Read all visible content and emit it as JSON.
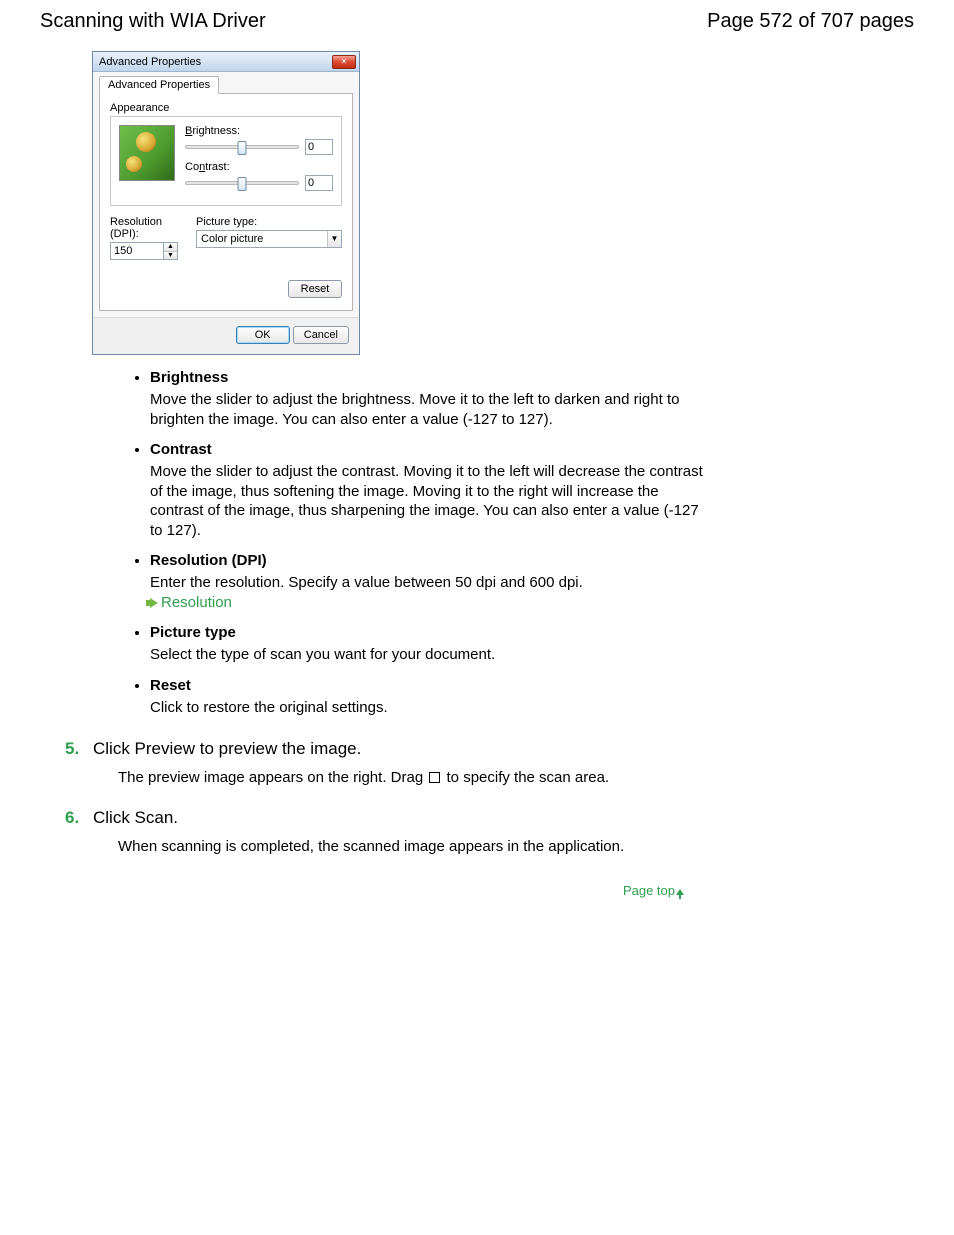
{
  "header": {
    "title": "Scanning with WIA Driver",
    "page_info": "Page 572 of 707 pages"
  },
  "dialog": {
    "title": "Advanced Properties",
    "tab_label": "Advanced Properties",
    "appearance_label": "Appearance",
    "brightness_label_pre": "B",
    "brightness_label_rest": "rightness:",
    "brightness_value": "0",
    "contrast_label_pre": "Co",
    "contrast_label_u": "n",
    "contrast_label_rest": "trast:",
    "contrast_value": "0",
    "resolution_label_pre": "R",
    "resolution_label_rest": "esolution (DPI):",
    "resolution_value": "150",
    "picture_type_label_pre": "Picture t",
    "picture_type_label_u": "y",
    "picture_type_label_rest": "pe:",
    "picture_type_value": "Color picture",
    "reset_label": "Reset",
    "ok_label": "OK",
    "cancel_label": "Cancel"
  },
  "items": {
    "brightness": {
      "title": "Brightness",
      "body": "Move the slider to adjust the brightness. Move it to the left to darken and right to brighten the image. You can also enter a value (-127 to 127)."
    },
    "contrast": {
      "title": "Contrast",
      "body": "Move the slider to adjust the contrast. Moving it to the left will decrease the contrast of the image, thus softening the image. Moving it to the right will increase the contrast of the image, thus sharpening the image. You can also enter a value (-127 to 127)."
    },
    "resolution": {
      "title": "Resolution (DPI)",
      "body": "Enter the resolution. Specify a value between 50 dpi and 600 dpi.",
      "link": "Resolution"
    },
    "picture_type": {
      "title": "Picture type",
      "body": "Select the type of scan you want for your document."
    },
    "reset": {
      "title": "Reset",
      "body": "Click to restore the original settings."
    }
  },
  "steps": {
    "s5": {
      "num": "5.",
      "title": "Click Preview to preview the image.",
      "sub_pre": "The preview image appears on the right. Drag ",
      "sub_post": " to specify the scan area."
    },
    "s6": {
      "num": "6.",
      "title": "Click Scan.",
      "sub": "When scanning is completed, the scanned image appears in the application."
    }
  },
  "page_top": "Page top"
}
